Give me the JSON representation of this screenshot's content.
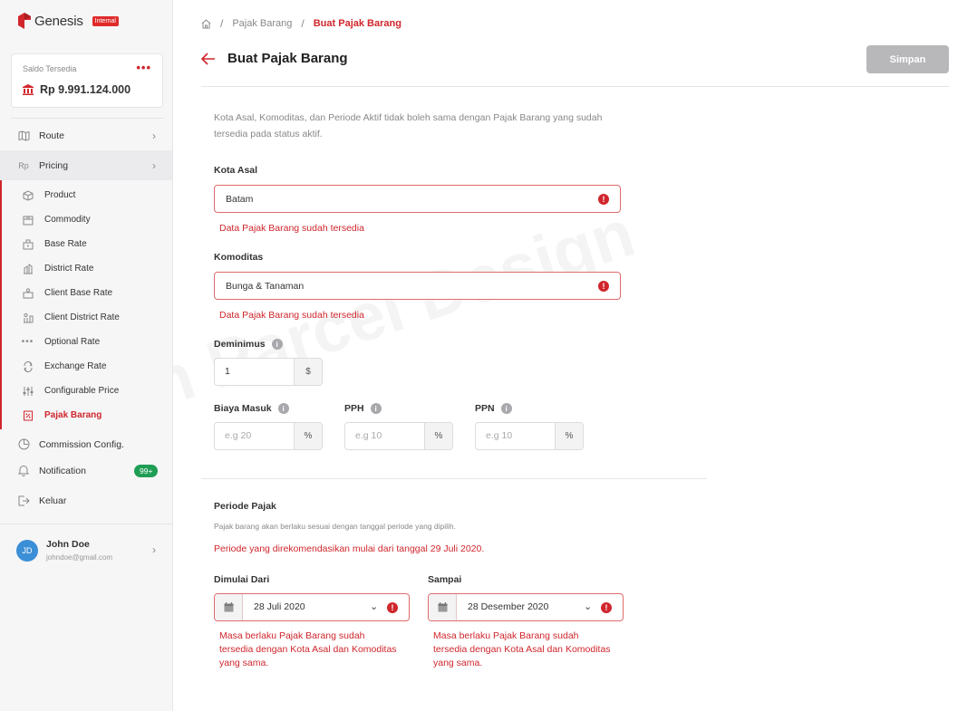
{
  "app": {
    "logo_text": "Genesis",
    "logo_badge": "Internal"
  },
  "balance": {
    "label": "Saldo Tersedia",
    "value": "Rp 9.991.124.000",
    "more": "•••"
  },
  "sidebar": {
    "items": [
      {
        "label": "Route",
        "icon": "map-icon"
      },
      {
        "label": "Pricing",
        "icon": "currency-rp-icon"
      }
    ],
    "pricing_children": [
      {
        "label": "Product",
        "icon": "box-icon"
      },
      {
        "label": "Commodity",
        "icon": "package-icon"
      },
      {
        "label": "Base Rate",
        "icon": "base-rate-icon"
      },
      {
        "label": "District Rate",
        "icon": "district-rate-icon"
      },
      {
        "label": "Client Base Rate",
        "icon": "client-base-rate-icon"
      },
      {
        "label": "Client District Rate",
        "icon": "client-district-rate-icon"
      },
      {
        "label": "Optional Rate",
        "icon": "more-horizontal-icon"
      },
      {
        "label": "Exchange Rate",
        "icon": "exchange-icon"
      },
      {
        "label": "Configurable Price",
        "icon": "sliders-icon"
      },
      {
        "label": "Pajak Barang",
        "icon": "receipt-icon",
        "active": true
      }
    ],
    "commission": "Commission Config.",
    "notification": "Notification",
    "notification_badge": "99+",
    "logout": "Keluar"
  },
  "user": {
    "initials": "JD",
    "name": "John Doe",
    "email": "johndoe@gmail.com"
  },
  "breadcrumb": {
    "parent": "Pajak Barang",
    "current": "Buat Pajak Barang",
    "sep": "/"
  },
  "header": {
    "title": "Buat Pajak Barang",
    "save_label": "Simpan"
  },
  "form": {
    "info": "Kota Asal, Komoditas, dan Periode Aktif tidak boleh sama dengan Pajak Barang yang sudah tersedia pada status aktif.",
    "kota_asal": {
      "label": "Kota Asal",
      "value": "Batam",
      "error": "Data Pajak Barang sudah tersedia"
    },
    "komoditas": {
      "label": "Komoditas",
      "value": "Bunga & Tanaman",
      "error": "Data Pajak Barang sudah tersedia"
    },
    "deminimus": {
      "label": "Deminimus",
      "value": "1",
      "unit": "$"
    },
    "biaya_masuk": {
      "label": "Biaya Masuk",
      "placeholder": "e.g 20",
      "unit": "%"
    },
    "pph": {
      "label": "PPH",
      "placeholder": "e.g 10",
      "unit": "%"
    },
    "ppn": {
      "label": "PPN",
      "placeholder": "e.g 10",
      "unit": "%"
    }
  },
  "periode": {
    "title": "Periode Pajak",
    "subtitle": "Pajak barang akan berlaku sesuai dengan tanggal periode yang dipilih.",
    "recommendation": "Periode yang direkomendasikan mulai dari tanggal 29 Juli 2020.",
    "start": {
      "label": "Dimulai Dari",
      "value": "28 Juli 2020",
      "error": "Masa berlaku Pajak Barang sudah tersedia dengan Kota Asal dan Komoditas yang sama."
    },
    "end": {
      "label": "Sampai",
      "value": "28 Desember 2020",
      "error": "Masa berlaku Pajak Barang sudah tersedia dengan Kota Asal dan Komoditas yang sama."
    }
  },
  "watermark": "Lion Parcel Design",
  "colors": {
    "accent": "#d0262c",
    "success": "#1f9d55",
    "avatar": "#3b8fd6",
    "disabled": "#b8b8bb"
  }
}
